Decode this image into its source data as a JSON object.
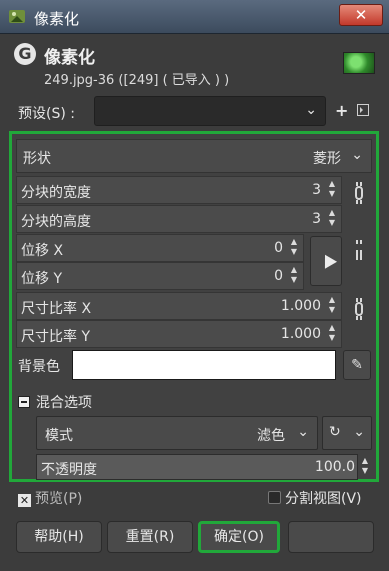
{
  "window": {
    "title": "像素化",
    "close_label": "✕"
  },
  "header": {
    "title": "像素化",
    "subtitle": "249.jpg-36 ([249] ( 已导入 ) )",
    "logo_letter": "G"
  },
  "presets": {
    "label": "预设(S) :",
    "value": ""
  },
  "shape": {
    "label": "形状",
    "value": "菱形"
  },
  "fields": {
    "block_width": {
      "label": "分块的宽度",
      "value": "3"
    },
    "block_height": {
      "label": "分块的高度",
      "value": "3"
    },
    "offset_x": {
      "label": "位移 X",
      "value": "0"
    },
    "offset_y": {
      "label": "位移 Y",
      "value": "0"
    },
    "ratio_x": {
      "label": "尺寸比率 X",
      "value": "1.000"
    },
    "ratio_y": {
      "label": "尺寸比率 Y",
      "value": "1.000"
    }
  },
  "background": {
    "label": "背景色",
    "color": "#ffffff"
  },
  "blending": {
    "header": "混合选项",
    "mode_label": "模式",
    "mode_value": "滤色",
    "opacity_label": "不透明度",
    "opacity_value": "100.0"
  },
  "bottom": {
    "preview_label": "预览(P)",
    "split_label": "分割视图(V)"
  },
  "buttons": {
    "help": "帮助(H)",
    "reset": "重置(R)",
    "ok": "确定(O)"
  },
  "colors": {
    "highlight": "#21a83a"
  }
}
